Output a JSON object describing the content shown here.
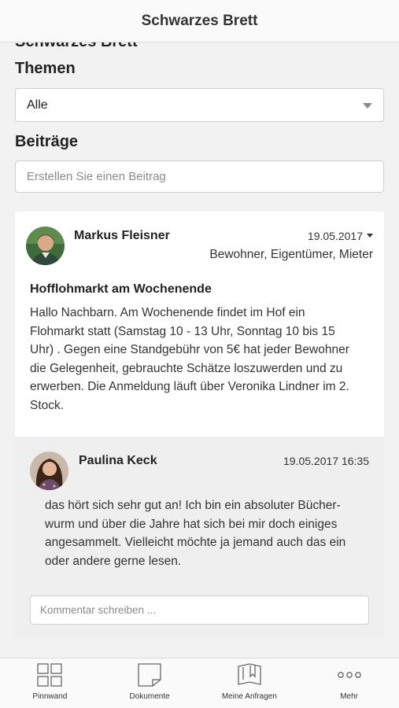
{
  "header": {
    "title": "Schwarzes Brett"
  },
  "ghost_title": "Schwarzes Brett",
  "themes": {
    "label": "Themen",
    "selected": "Alle"
  },
  "posts_section": {
    "label": "Beiträge",
    "placeholder": "Erstellen Sie einen Beitrag"
  },
  "post": {
    "author": "Markus Fleisner",
    "date": "19.05.2017",
    "audience": "Bewohner, Eigentümer, Mieter",
    "title": "Hofflohmarkt am Wochenende",
    "body_lines": [
      "Hallo Nachbarn. Am Wochenende findet im Hof ein",
      "Flohmarkt statt (Samstag 10 - 13 Uhr, Sonntag 10 bis 15",
      "Uhr) . Gegen eine Standgebühr von 5€ hat jeder Bewohner",
      "die Gelegenheit, gebrauchte Schätze loszuwerden und zu",
      "erwerben. Die Anmeldung läuft über Veronika Lindner im 2.",
      "Stock."
    ]
  },
  "comment": {
    "author": "Paulina Keck",
    "date": "19.05.2017 16:35",
    "body_lines": [
      "das hört sich sehr gut an! Ich bin ein absoluter Bücher-",
      "wurm und über die Jahre hat sich bei mir doch einiges",
      "angesammelt. Vielleicht möchte ja jemand auch das ein",
      "oder andere gerne lesen."
    ],
    "input_placeholder": "Kommentar schreiben ..."
  },
  "tabbar": {
    "items": [
      {
        "label": "Pinnwand",
        "icon": "grid-icon"
      },
      {
        "label": "Dokumente",
        "icon": "document-icon"
      },
      {
        "label": "Meine Anfragen",
        "icon": "requests-icon"
      },
      {
        "label": "Mehr",
        "icon": "more-icon"
      }
    ]
  }
}
